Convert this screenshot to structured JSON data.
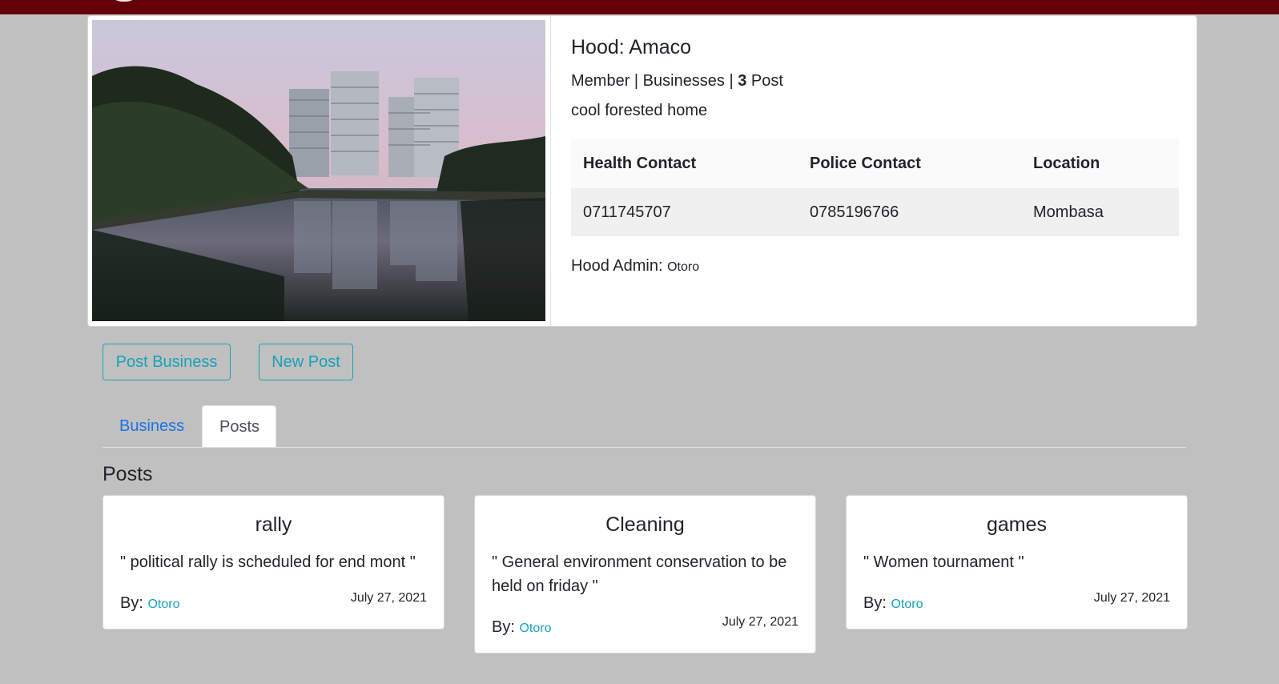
{
  "hood": {
    "title": "Hood: Amaco",
    "stats_prefix": "Member | Businesses | ",
    "post_count": "3",
    "stats_suffix": " Post",
    "description": "cool forested home",
    "admin_label": "Hood Admin: ",
    "admin_name": "Otoro",
    "image_alt": "forested riverside apartment towers"
  },
  "contacts": {
    "headers": [
      "Health Contact",
      "Police Contact",
      "Location"
    ],
    "row": [
      "0711745707",
      "0785196766",
      "Mombasa"
    ]
  },
  "actions": {
    "post_business": "Post Business",
    "new_post": "New Post"
  },
  "tabs": {
    "business": "Business",
    "posts": "Posts"
  },
  "posts_section": {
    "heading": "Posts",
    "by_label": "By: ",
    "items": [
      {
        "title": "rally",
        "body": "\" political rally is scheduled for end mont \"",
        "author": "Otoro",
        "date": "July 27, 2021"
      },
      {
        "title": "Cleaning",
        "body": "\" General environment conservation to be held on friday \"",
        "author": "Otoro",
        "date": "July 27, 2021"
      },
      {
        "title": "games",
        "body": "\" Women tournament \"",
        "author": "Otoro",
        "date": "July 27, 2021"
      }
    ]
  },
  "colors": {
    "topbar": "#65000b",
    "page_bg": "#c0c0c0",
    "accent_info": "#17a2b8",
    "tab_link": "#1a73e8"
  }
}
